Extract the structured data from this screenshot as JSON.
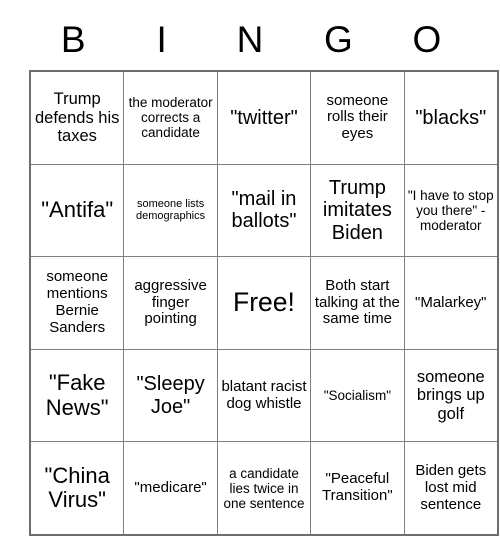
{
  "card": {
    "title": "BINGO",
    "header_letters": [
      "B",
      "I",
      "N",
      "G",
      "O"
    ],
    "rows": [
      [
        {
          "text": "Trump defends his taxes",
          "size": "s16"
        },
        {
          "text": "the moderator corrects a candidate",
          "size": "s12"
        },
        {
          "text": "\"twitter\"",
          "size": "s20"
        },
        {
          "text": "someone rolls their eyes",
          "size": "s14"
        },
        {
          "text": "\"blacks\"",
          "size": "s20"
        }
      ],
      [
        {
          "text": "\"Antifa\"",
          "size": "s22"
        },
        {
          "text": "someone lists demographics",
          "size": "s9"
        },
        {
          "text": "\"mail in ballots\"",
          "size": "s20"
        },
        {
          "text": "Trump imitates Biden",
          "size": "s20"
        },
        {
          "text": "\"I have to stop you there\" -moderator",
          "size": "s12"
        }
      ],
      [
        {
          "text": "someone mentions Bernie Sanders",
          "size": "s14"
        },
        {
          "text": "aggressive finger pointing",
          "size": "s14"
        },
        {
          "text": "Free!",
          "size": "s26"
        },
        {
          "text": "Both start talking at the same time",
          "size": "s14"
        },
        {
          "text": "\"Malarkey\"",
          "size": "s14"
        }
      ],
      [
        {
          "text": "\"Fake News\"",
          "size": "s22"
        },
        {
          "text": "\"Sleepy Joe\"",
          "size": "s20"
        },
        {
          "text": "blatant racist dog whistle",
          "size": "s14"
        },
        {
          "text": "\"Socialism\"",
          "size": "s12"
        },
        {
          "text": "someone brings up golf",
          "size": "s16"
        }
      ],
      [
        {
          "text": "\"China Virus\"",
          "size": "s22"
        },
        {
          "text": "\"medicare\"",
          "size": "s14"
        },
        {
          "text": "a candidate lies twice in one sentence",
          "size": "s12"
        },
        {
          "text": "\"Peaceful Transition\"",
          "size": "s14"
        },
        {
          "text": "Biden gets lost mid sentence",
          "size": "s14"
        }
      ]
    ]
  },
  "colors": {
    "background": "#ffffff",
    "text": "#000000",
    "cell_border": "#808080",
    "outer_border": "#6e6e6e"
  }
}
